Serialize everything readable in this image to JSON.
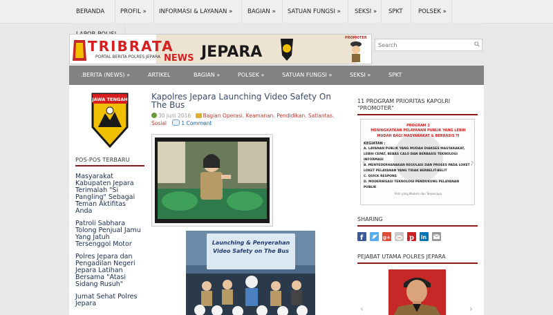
{
  "top_nav": {
    "items": [
      "BERANDA",
      "PROFIL",
      "INFORMASI & LAYANAN",
      "BAGIAN",
      "SATUAN FUNGSI",
      "SEKSI",
      "SPKT",
      "POLSEK"
    ],
    "lapor": "LAPOR POLISI"
  },
  "banner": {
    "title_tribrata": "TRIBRATA",
    "title_news": "NEWS",
    "title_place": "JEPARA",
    "subtitle": "PORTAL BERITA POLRES JEPARA",
    "promoter_tag": "PROMOTER"
  },
  "search": {
    "placeholder": "Search"
  },
  "main_nav": {
    "items": [
      ".BERITA (NEWS)",
      "ARTIKEL",
      "BAGIAN",
      "POLSEK",
      "SATUAN FUNGSI",
      "SEKSI",
      "SPKT"
    ]
  },
  "sidebar_left": {
    "badge_text": "JAWA TENGAH",
    "recent_title": "POS-POS TERBARU",
    "posts": [
      "Masyarakat Kabupaten Jepara Terimalah \"Si Pangling\" Sebagai Teman Aktifitas Anda",
      "Patroli Sabhara Tolong Penjual Jamu Yang Jatuh Tersenggol Motor",
      "Polres Jepara dan Pengadilan Negeri Jepara Latihan Bersama \"Atasi Sidang Rusuh\"",
      "Jumat Sehat Polres Jepara"
    ]
  },
  "article": {
    "title": "Kapolres Jepara Launching Video Safety On The Bus",
    "date": "30 Juni 2016",
    "categories": [
      "Bagian Operasi",
      "Keamanan",
      "Pendidikan",
      "Satlantas",
      "Sosial"
    ],
    "comments": "1 Comment",
    "photo_banner_line1": "Launching & Penyerahan",
    "photo_banner_line2": "Video Safety on The Bus"
  },
  "sidebar_right": {
    "program_title": "11 PROGRAM PRIORITAS KAPOLRI \"PROMOTER\"",
    "slide": {
      "heading1": "PROGRAM 2",
      "heading2": "MENINGKATKAN PELAYANAN PUBLIK YANG LEBIH MUDAH BAGI MASYARAKAT & BERBASIS TI",
      "kegiatan": "KEGIATAN :",
      "lines": [
        "A. LAYANAN PUBLIK YANG MUDAH DIAKSES MASYARAKAT, LEBIH CEPAT, BEBAS CALO DAN BERBASIS TEKNOLOGI INFORMASI",
        "B. MENYEDERHANAKAN REGULASI DAN PROSES PADA LOKET - LOKET PELAYANAN YANG TIDAK BERBELIT-BELIT",
        "C. QUICK RESPONS",
        "D. MODERNISASI TEKNOLOGI PENDUKUNG PELAYANAN PUBLIK"
      ],
      "footer": "Polri yang Modern dan Terpercaya"
    },
    "sharing_title": "SHARING",
    "share_colors": [
      "#3b5998",
      "#55acee",
      "#dd4b39",
      "#888888",
      "#cb2027",
      "#0077b5",
      "#999999"
    ],
    "officials_title": "PEJABAT UTAMA POLRES JEPARA"
  }
}
